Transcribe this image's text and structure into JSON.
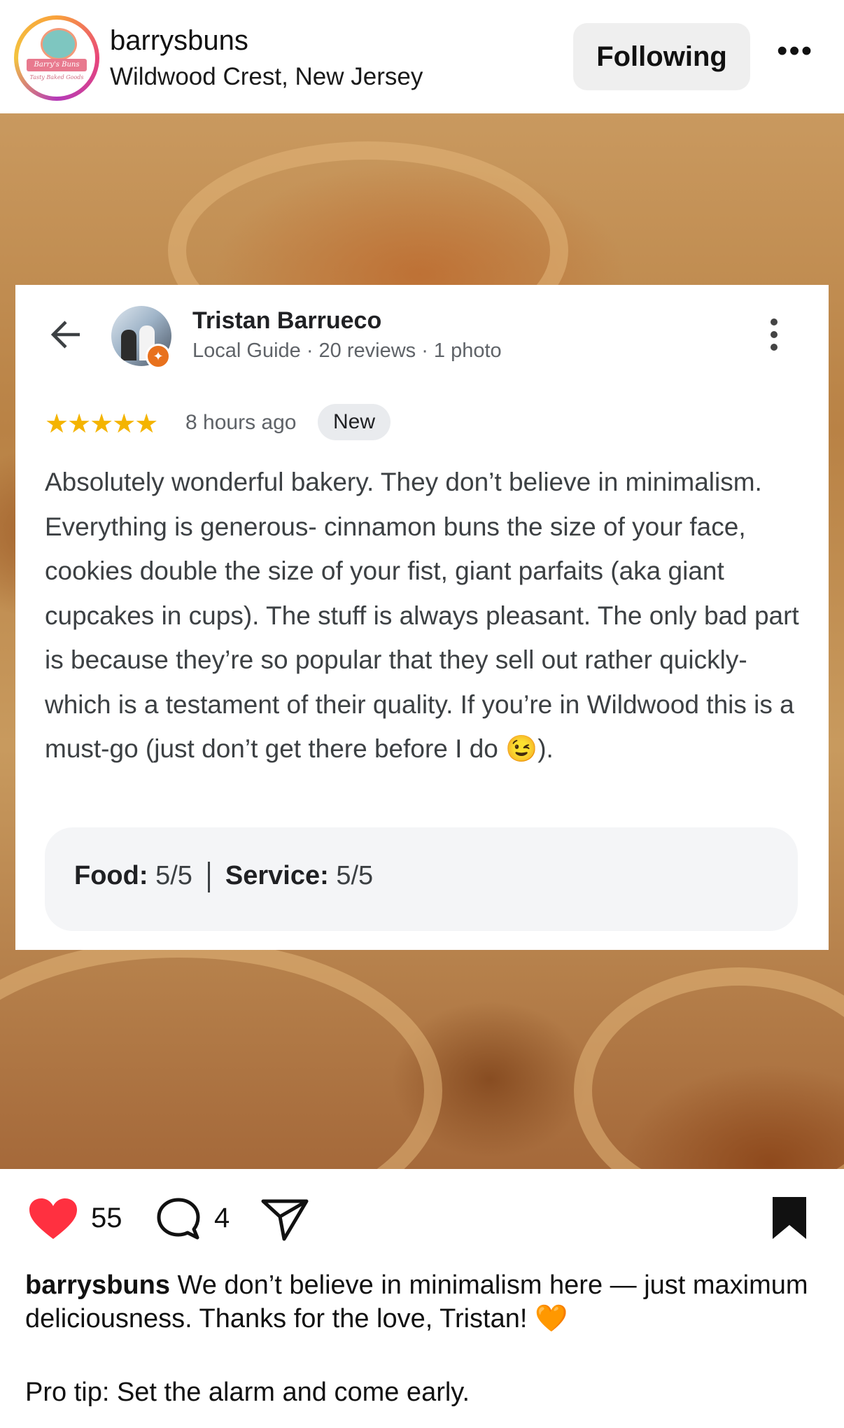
{
  "post": {
    "username": "barrysbuns",
    "location": "Wildwood Crest, New Jersey",
    "follow_label": "Following",
    "more_label": "•••",
    "logo_text": "Barry's Buns",
    "logo_sub": "Tasty Baked Goods"
  },
  "review": {
    "reviewer_name": "Tristan Barrueco",
    "reviewer_meta": "Local Guide · 20 reviews · 1 photo",
    "stars": "★★★★★",
    "rating": 5,
    "time": "8 hours ago",
    "badge": "New",
    "text": "Absolutely wonderful bakery. They don’t believe in minimalism. Everything is generous- cinnamon buns the size of your face, cookies double the size of your fist, giant parfaits (aka giant cupcakes in cups). The stuff is always pleasant. The only bad part is because they’re so popular that they sell out rather quickly- which is a testament of their quality. If you’re in Wildwood this is a must-go (just don’t get there before I do 😉).",
    "food_label": "Food:",
    "food_value": " 5/5",
    "service_label": "Service:",
    "service_value": " 5/5"
  },
  "actions": {
    "likes": "55",
    "comments": "4",
    "heart_color": "#ff3040"
  },
  "caption": {
    "username": "barrysbuns",
    "text": " We don’t believe in minimalism here — just maximum deliciousness. Thanks for the love, Tristan! 🧡",
    "protip": "Pro tip: Set the alarm and come early."
  }
}
